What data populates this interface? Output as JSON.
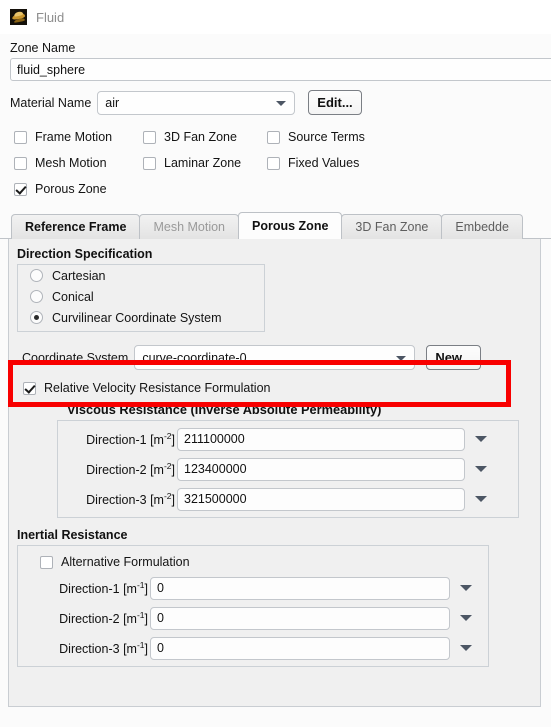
{
  "window": {
    "title": "Fluid",
    "icon": "fluid-zone-icon"
  },
  "zone": {
    "name_label": "Zone Name",
    "name_value": "fluid_sphere",
    "material_label": "Material Name",
    "material_value": "air",
    "edit_label": "Edit..."
  },
  "options": [
    {
      "label": "Frame Motion",
      "checked": false
    },
    {
      "label": "3D Fan Zone",
      "checked": false
    },
    {
      "label": "Source Terms",
      "checked": false
    },
    {
      "label": "Mesh Motion",
      "checked": false
    },
    {
      "label": "Laminar Zone",
      "checked": false
    },
    {
      "label": "Fixed Values",
      "checked": false
    },
    {
      "label": "Porous Zone",
      "checked": true
    }
  ],
  "tabs": [
    {
      "label": "Reference Frame",
      "state": "strong"
    },
    {
      "label": "Mesh Motion",
      "state": "disabled"
    },
    {
      "label": "Porous Zone",
      "state": "active"
    },
    {
      "label": "3D Fan Zone",
      "state": "normal"
    },
    {
      "label": "Embedde",
      "state": "normal"
    }
  ],
  "direction_spec": {
    "title": "Direction Specification",
    "options": [
      {
        "label": "Cartesian",
        "selected": false
      },
      {
        "label": "Conical",
        "selected": false
      },
      {
        "label": "Curvilinear Coordinate System",
        "selected": true
      }
    ]
  },
  "coordinate_system": {
    "label": "Coordinate System",
    "value": "curve-coordinate-0",
    "new_label": "New...",
    "highlight_color": "#f80000"
  },
  "relative_velocity": {
    "label": "Relative Velocity Resistance Formulation",
    "checked": true
  },
  "viscous_resistance": {
    "title": "Viscous Resistance (Inverse Absolute Permeability)",
    "unit_base": "[m",
    "unit_exp": "-2",
    "unit_close": "]",
    "rows": [
      {
        "label": "Direction-1",
        "value": "211100000"
      },
      {
        "label": "Direction-2",
        "value": "123400000"
      },
      {
        "label": "Direction-3",
        "value": "321500000"
      }
    ]
  },
  "inertial_resistance": {
    "title": "Inertial Resistance",
    "alt_label": "Alternative Formulation",
    "alt_checked": false,
    "unit_base": "[m",
    "unit_exp": "-1",
    "unit_close": "]",
    "rows": [
      {
        "label": "Direction-1",
        "value": "0"
      },
      {
        "label": "Direction-2",
        "value": "0"
      },
      {
        "label": "Direction-3",
        "value": "0"
      }
    ]
  }
}
